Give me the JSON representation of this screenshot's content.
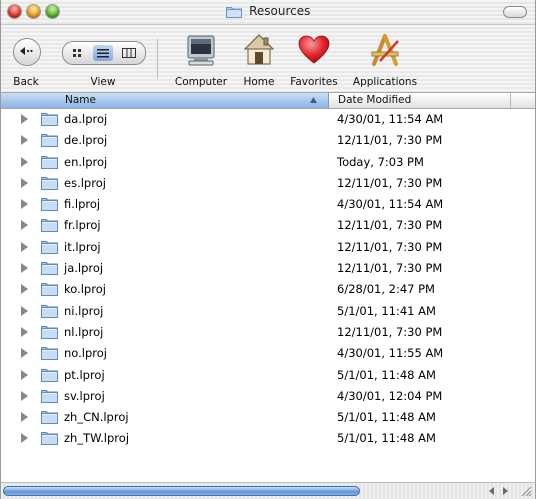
{
  "window": {
    "title": "Resources",
    "colors": {
      "close": "#e23a2d",
      "minimize": "#f0a51c",
      "zoom": "#5bba2f",
      "selection": "#8cb4e3"
    }
  },
  "toolbar": {
    "back_label": "Back",
    "view_label": "View",
    "computer_label": "Computer",
    "home_label": "Home",
    "favorites_label": "Favorites",
    "applications_label": "Applications",
    "view_options": [
      "icon-view",
      "list-view",
      "column-view"
    ],
    "active_view": "list-view"
  },
  "list": {
    "columns": {
      "name": "Name",
      "date": "Date Modified"
    },
    "sorted_by": "name",
    "rows": [
      {
        "name": "da.lproj",
        "date": "4/30/01, 11:54 AM"
      },
      {
        "name": "de.lproj",
        "date": "12/11/01, 7:30 PM"
      },
      {
        "name": "en.lproj",
        "date": "Today, 7:03 PM"
      },
      {
        "name": "es.lproj",
        "date": "12/11/01, 7:30 PM"
      },
      {
        "name": "fi.lproj",
        "date": "4/30/01, 11:54 AM"
      },
      {
        "name": "fr.lproj",
        "date": "12/11/01, 7:30 PM"
      },
      {
        "name": "it.lproj",
        "date": "12/11/01, 7:30 PM"
      },
      {
        "name": "ja.lproj",
        "date": "12/11/01, 7:30 PM"
      },
      {
        "name": "ko.lproj",
        "date": "6/28/01, 2:47 PM"
      },
      {
        "name": "ni.lproj",
        "date": "5/1/01, 11:41 AM"
      },
      {
        "name": "nl.lproj",
        "date": "12/11/01, 7:30 PM"
      },
      {
        "name": "no.lproj",
        "date": "4/30/01, 11:55 AM"
      },
      {
        "name": "pt.lproj",
        "date": "5/1/01, 11:48 AM"
      },
      {
        "name": "sv.lproj",
        "date": "4/30/01, 12:04 PM"
      },
      {
        "name": "zh_CN.lproj",
        "date": "5/1/01, 11:48 AM"
      },
      {
        "name": "zh_TW.lproj",
        "date": "5/1/01, 11:48 AM"
      }
    ]
  },
  "scrollbar": {
    "position_fraction": 0.0,
    "visible_fraction": 0.68
  }
}
